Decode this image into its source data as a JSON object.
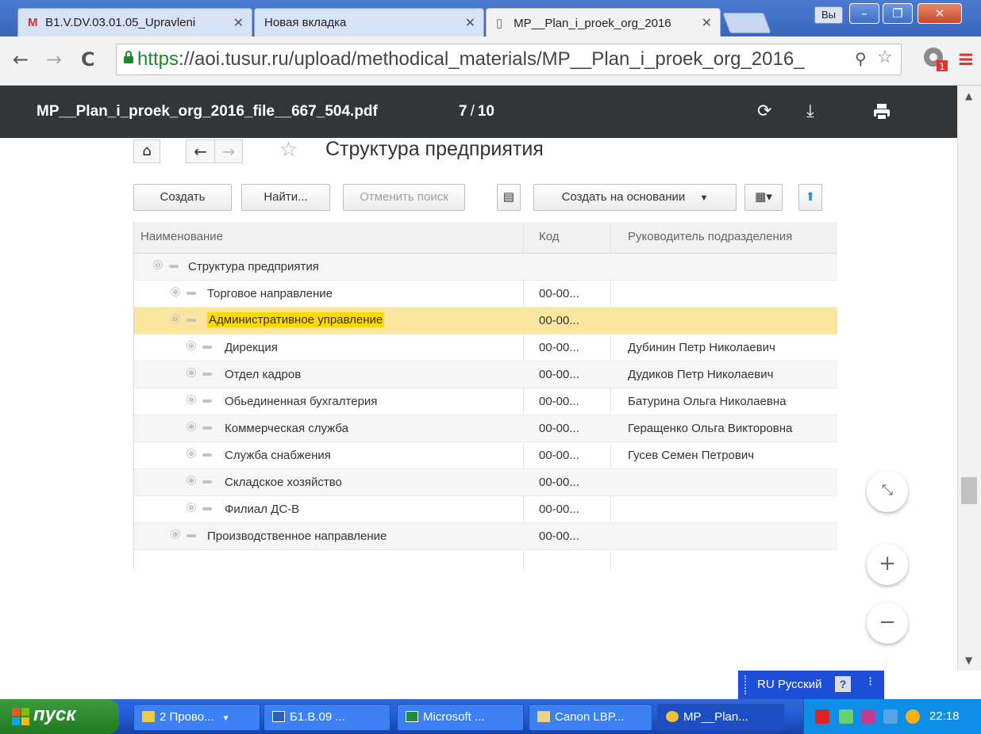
{
  "browser": {
    "tabs": [
      {
        "label": "B1.V.DV.03.01.05_Upravleni",
        "icon": "gmail-icon",
        "close": "✕"
      },
      {
        "label": "Новая вкладка",
        "icon": "",
        "close": "✕"
      },
      {
        "label": "MP__Plan_i_proek_org_2016",
        "icon": "page-icon",
        "close": "✕"
      }
    ],
    "lang_badge": "Вы",
    "url_scheme": "https",
    "url_rest": "://aoi.tusur.ru/upload/methodical_materials/MP__Plan_i_proek_org_2016_",
    "extension_badge": "1"
  },
  "pdf": {
    "filename": "MP__Plan_i_proek_org_2016_file__667_504.pdf",
    "page_current": "7",
    "page_sep": "/",
    "page_total": "10"
  },
  "form": {
    "title": "Структура предприятия",
    "buttons": {
      "create": "Создать",
      "find": "Найти...",
      "cancel_search": "Отменить поиск",
      "create_based": "Создать на основании"
    },
    "columns": [
      "Наименование",
      "Код",
      "Руководитель подразделения"
    ],
    "rows": [
      {
        "expand": "⊖",
        "name": "Структура предприятия",
        "code": "",
        "head": ""
      },
      {
        "expand": "⊕",
        "name": "Торговое направление",
        "code": "00-00...",
        "head": ""
      },
      {
        "expand": "⊖",
        "name": "Административное управление",
        "code": "00-00...",
        "head": ""
      },
      {
        "expand": "⊕",
        "name": "Дирекция",
        "code": "00-00...",
        "head": "Дубинин Петр Николаевич"
      },
      {
        "expand": "⊕",
        "name": "Отдел кадров",
        "code": "00-00...",
        "head": "Дудиков Петр Николаевич"
      },
      {
        "expand": "⊕",
        "name": "Обьединенная бухгалтерия",
        "code": "00-00...",
        "head": "Батурина Ольга Николаевна"
      },
      {
        "expand": "⊕",
        "name": "Коммерческая служба",
        "code": "00-00...",
        "head": "Геращенко Ольга Викторовна"
      },
      {
        "expand": "⊕",
        "name": "Служба снабжения",
        "code": "00-00...",
        "head": "Гусев Семен Петрович"
      },
      {
        "expand": "⊕",
        "name": "Складское хозяйство",
        "code": "00-00...",
        "head": ""
      },
      {
        "expand": "⊕",
        "name": "Филиал ДС-В",
        "code": "00-00...",
        "head": ""
      },
      {
        "expand": "⊕",
        "name": "Производственное направление",
        "code": "00-00...",
        "head": ""
      }
    ]
  },
  "viewer_controls": {
    "fit": "⤡",
    "zoom_in": "+",
    "zoom_out": "−"
  },
  "language_bar": {
    "label": "RU Русский",
    "help": "?"
  },
  "taskbar": {
    "start": "пуск",
    "items": [
      {
        "label": "2 Прово...",
        "icon": "folder-icon"
      },
      {
        "label": "Б1.В.09 ...",
        "icon": "word-icon"
      },
      {
        "label": "Microsoft ...",
        "icon": "excel-icon"
      },
      {
        "label": "Canon LBP...",
        "icon": "printer-icon"
      },
      {
        "label": "MP__Plan...",
        "icon": "chrome-icon"
      }
    ],
    "clock": "22:18"
  }
}
